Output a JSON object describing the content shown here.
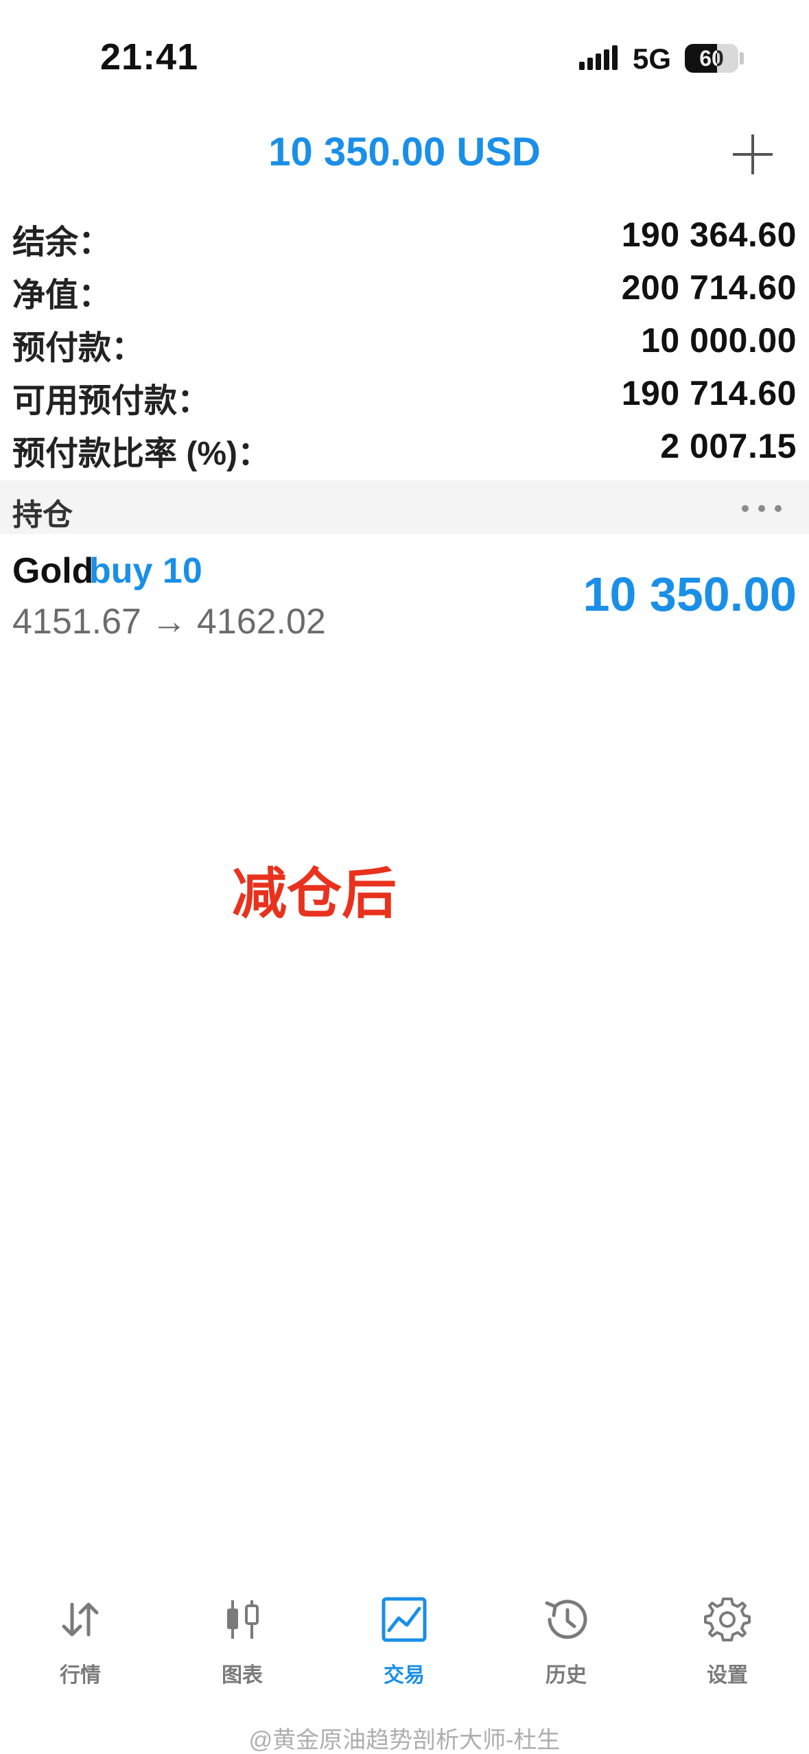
{
  "status_bar": {
    "time": "21:41",
    "network": "5G",
    "battery": "60",
    "battery_level": 0.6
  },
  "header": {
    "title": "10 350.00 USD"
  },
  "summary": [
    {
      "label": "结余：",
      "value": "190 364.60"
    },
    {
      "label": "净值：",
      "value": "200 714.60"
    },
    {
      "label": "预付款：",
      "value": "10 000.00"
    },
    {
      "label": "可用预付款：",
      "value": "190 714.60"
    },
    {
      "label": "预付款比率 (%)：",
      "value": "2 007.15"
    }
  ],
  "positions_section": {
    "title": "持仓"
  },
  "position": {
    "symbol": "Gold",
    "side": "buy 10",
    "prices": "4151.67 → 4162.02",
    "profit": "10 350.00"
  },
  "annotation": "减仓后",
  "tabs": [
    {
      "label": "行情",
      "icon": "quotes-arrows-icon",
      "active": false
    },
    {
      "label": "图表",
      "icon": "candlestick-chart-icon",
      "active": false
    },
    {
      "label": "交易",
      "icon": "trade-chart-icon",
      "active": true
    },
    {
      "label": "历史",
      "icon": "history-clock-icon",
      "active": false
    },
    {
      "label": "设置",
      "icon": "settings-gear-icon",
      "active": false
    }
  ],
  "watermark": "@黄金原油趋势剖析大师-杜生",
  "colors": {
    "accent": "#1a8fe8",
    "annotation": "#e8321e",
    "section_background": "#f4f4f4"
  }
}
